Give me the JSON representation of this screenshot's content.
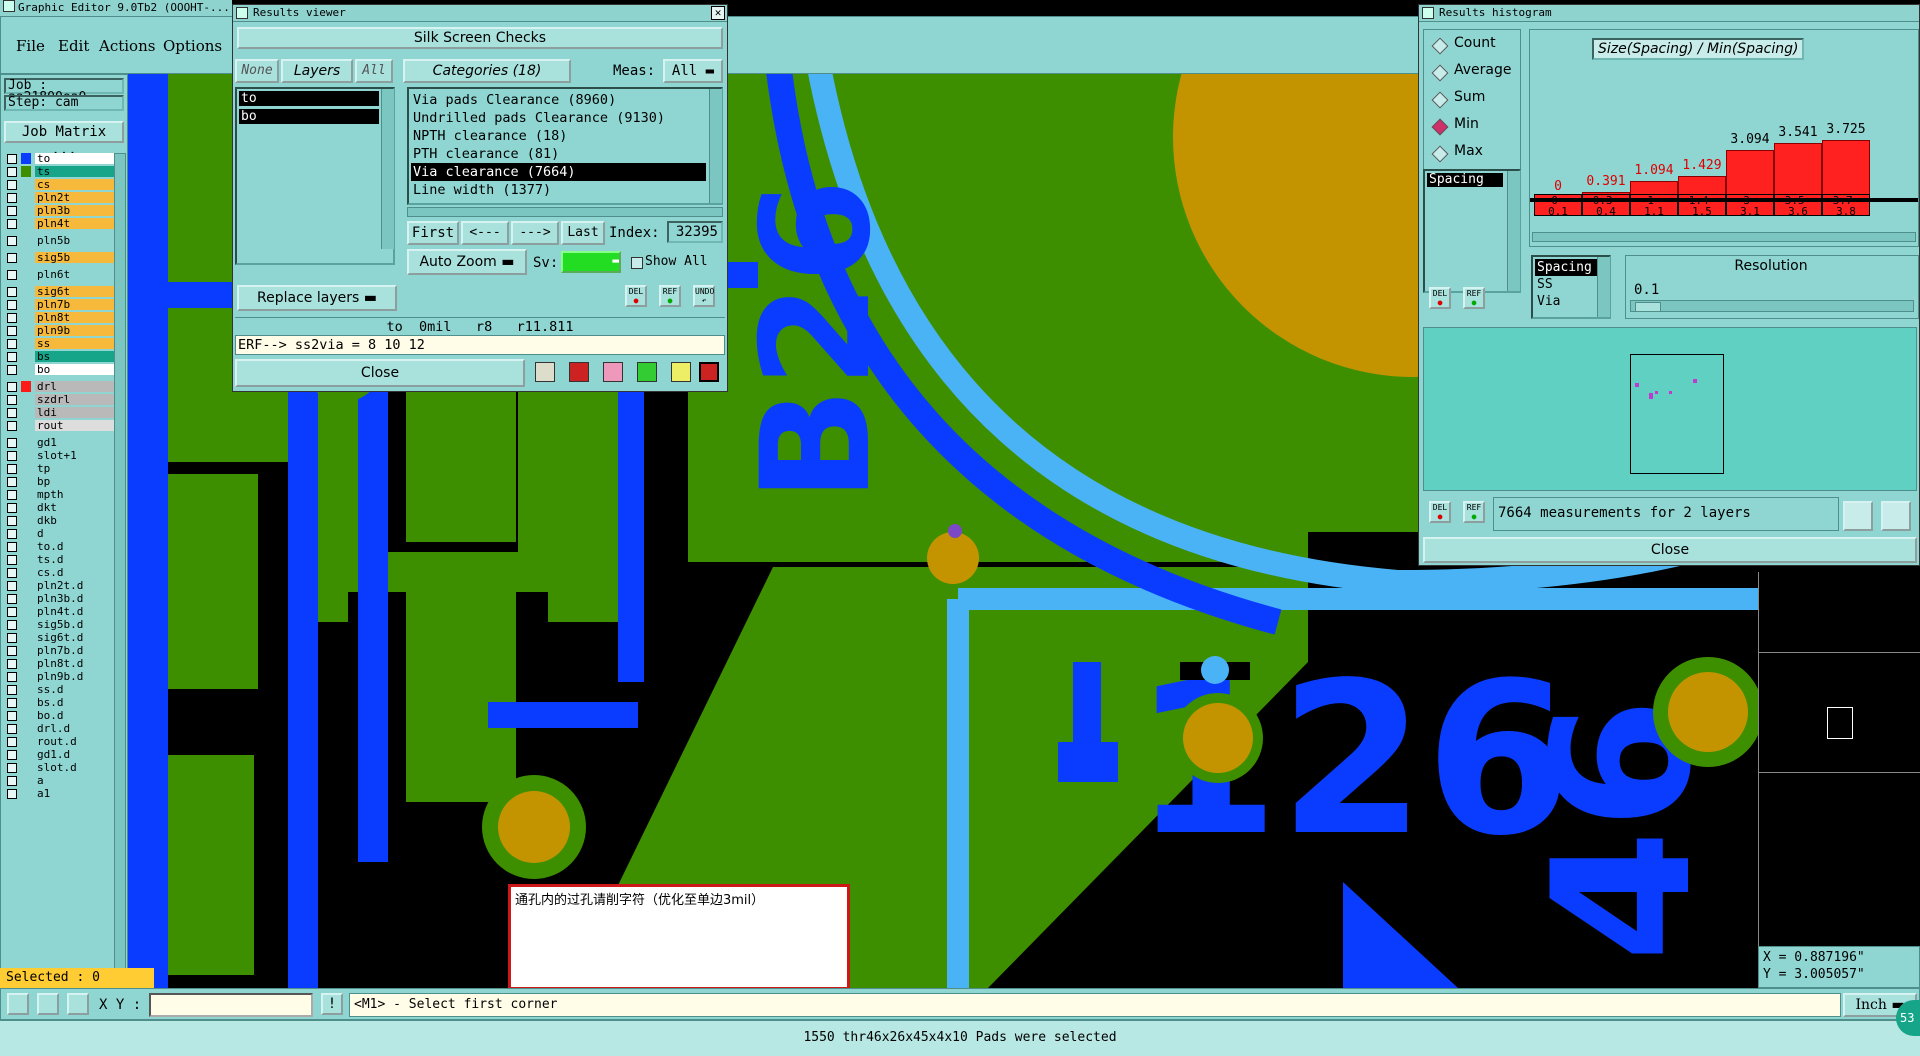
{
  "app": {
    "title": "Graphic Editor 9.0Tb2 (OOOHT-..."
  },
  "menu": [
    "File",
    "Edit",
    "Actions",
    "Options"
  ],
  "job": {
    "job_label": "Job : aa21800ea0",
    "step_label": "Step: cam",
    "matrix_button": "Job Matrix ..."
  },
  "layers": [
    "to",
    "ts",
    "cs",
    "pln2t",
    "pln3b",
    "pln4t",
    "pln5b",
    "sig5b",
    "pln6t",
    "sig6t",
    "pln7b",
    "pln8t",
    "pln9b",
    "ss",
    "bs",
    "bo",
    "drl",
    "szdrl",
    "ldi",
    "rout",
    "gd1",
    "slot+1",
    "tp",
    "bp",
    "mpth",
    "dkt",
    "dkb",
    "d",
    "to.d",
    "ts.d",
    "cs.d",
    "pln2t.d",
    "pln3b.d",
    "pln4t.d",
    "sig5b.d",
    "sig6t.d",
    "pln7b.d",
    "pln8t.d",
    "pln9b.d",
    "ss.d",
    "bs.d",
    "bo.d",
    "drl.d",
    "rout.d",
    "gd1.d",
    "slot.d",
    "a",
    "a1"
  ],
  "selected_label": "Selected : 0",
  "results_viewer": {
    "title": "Results viewer",
    "header": "Silk Screen Checks",
    "none_btn": "None",
    "layers_btn": "Layers",
    "all_btn": "All",
    "categories_btn": "Categories (18)",
    "meas_label": "Meas:",
    "meas_value": "All",
    "layer_list": [
      "to",
      "bo"
    ],
    "categories": [
      "Via pads Clearance (8960)",
      "Undrilled pads Clearance (9130)",
      "NPTH clearance (18)",
      "PTH clearance (81)",
      "Via clearance (7664)",
      "Line width (1377)"
    ],
    "selected_category_index": 4,
    "nav": {
      "first": "First",
      "prev": "<---",
      "next": "--->",
      "last": "Last",
      "index_label": "Index:",
      "index_value": "32395"
    },
    "auto_zoom": "Auto Zoom",
    "sv_label": "Sv:",
    "show_all": "Show All",
    "replace_layers": "Replace layers",
    "status_line": "to  0mil   r8   r11.811",
    "erf_line": "ERF--> ss2via = 8 10 12",
    "close": "Close",
    "del": "DEL",
    "ref": "REF",
    "undo": "UNDO"
  },
  "histogram": {
    "title": "Results histogram",
    "options": [
      "Count",
      "Average",
      "Sum",
      "Min",
      "Max"
    ],
    "selected_option": "Min",
    "chart_title": "Size(Spacing) / Min(Spacing)",
    "bins": [
      "0-\n0.1",
      "0.3-\n0.4",
      "1-\n1.1",
      "1.4-\n1.5",
      "3-\n3.1",
      "3.5-\n3.6",
      "3.7-\n3.8"
    ],
    "values": [
      0,
      0.391,
      1.094,
      1.429,
      3.094,
      3.541,
      3.725
    ],
    "value_labels": [
      "0",
      "0.391",
      "1.094",
      "1.429",
      "3.094",
      "3.541",
      "3.725"
    ],
    "spacing_list_top": "Spacing",
    "attr_list": [
      "Spacing",
      "SS",
      "Via"
    ],
    "resolution_label": "Resolution",
    "resolution_value": "0.1",
    "measurements": "7664 measurements for 2 layers",
    "close": "Close",
    "del": "DEL",
    "ref": "REF"
  },
  "annotation_box": "通孔内的过孔请削字符（优化至单边3mil）",
  "coords": {
    "x": "X = 0.887196\"",
    "y": "Y = 3.005057\""
  },
  "bottom": {
    "xy_label": "X Y :",
    "prompt": "<M1> - Select first corner",
    "units": "Inch",
    "status": "1550 thr46x26x45x4x10 Pads were selected",
    "corner_badge": "53"
  },
  "colors": {
    "panel": "#8fd6d2",
    "silk_blue": "#0a3cff",
    "cyan_line": "#4ab3f5",
    "board_green": "#3d8f00",
    "pad_gold": "#c49400",
    "hist_red": "#ff2020"
  }
}
